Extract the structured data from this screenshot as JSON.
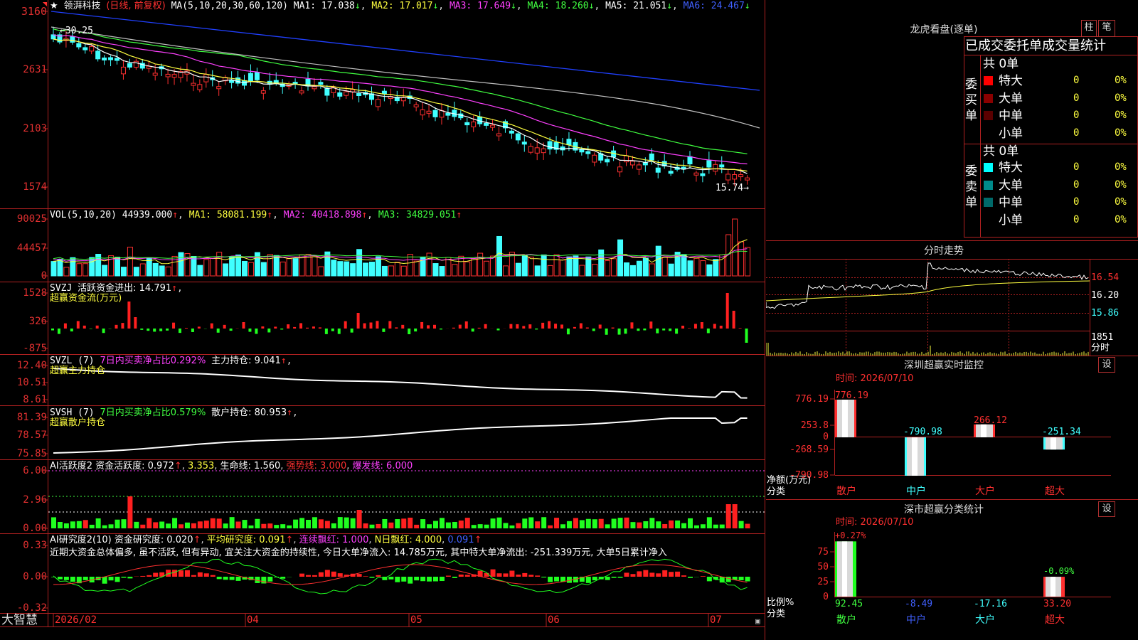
{
  "main_chart": {
    "stock_name": "领湃科技",
    "period": "(日线, 前复权)",
    "ma_params": "MA(5,10,20,30,60,120)",
    "ma": [
      {
        "label": "MA1: 17.038",
        "color": "#ffffff"
      },
      {
        "label": "MA2: 17.017",
        "color": "#ffff40"
      },
      {
        "label": "MA3: 17.649",
        "color": "#ff40ff"
      },
      {
        "label": "MA4: 18.260",
        "color": "#40ff40"
      },
      {
        "label": "MA5: 21.051",
        "color": "#ffffff"
      },
      {
        "label": "MA6: 24.467",
        "color": "#4060ff"
      }
    ],
    "y_ticks": [
      "3160",
      "2631",
      "2103",
      "1574"
    ],
    "high_label": "30.25",
    "low_label": "15.74"
  },
  "vol": {
    "title": "VOL(5,10,20)",
    "value": "44939.000",
    "ma1": "MA1: 58081.199",
    "ma2": "MA2: 40418.898",
    "ma3": "MA3: 34829.051",
    "y_ticks": [
      "90025",
      "44457",
      "0"
    ]
  },
  "svzj": {
    "title": "SVZJ",
    "line1": "活跃资金进出: 14.791",
    "line2": "超赢资金流(万元)",
    "y_ticks": [
      "1528",
      "326",
      "-875"
    ]
  },
  "svzl": {
    "title": "SVZL (7)",
    "ratio": "7日内买卖净占比0.292%",
    "hold": "主力持仓: 9.041",
    "line2": "超赢主力持仓",
    "y_ticks": [
      "12.40",
      "10.51",
      "8.61"
    ]
  },
  "svsh": {
    "title": "SVSH (7)",
    "ratio": "7日内买卖净占比0.579%",
    "hold": "散户持仓: 80.953",
    "line2": "超赢散户持仓",
    "y_ticks": [
      "81.39",
      "78.57",
      "75.85"
    ]
  },
  "ai_active": {
    "title": "AI活跃度2",
    "a": "资金活跃度: 0.972",
    "b": "3.353",
    "c": "生命线: 1.560",
    "d": "强势线: 3.000",
    "e": "爆发线: 6.000",
    "y_ticks": [
      "6.00",
      "2.96",
      "0.00"
    ]
  },
  "ai_research": {
    "title": "AI研究度2(10)",
    "a": "资金研究度: 0.020",
    "b": "平均研究度: 0.091",
    "c": "连续飘红: 1.000",
    "d": "N日飘红: 4.000",
    "e": "0.091",
    "comment": "近期大资金总体偏多, 虽不活跃, 但有异动, 宜关注大资金的持续性, 今日大单净流入: 14.785万元, 其中特大单净流出: -251.339万元, 大单5日累计净入",
    "y_ticks": [
      "0.33",
      "0.00",
      "-0.32"
    ]
  },
  "x_axis": {
    "brand": "大智慧",
    "labels": [
      "2026/02",
      "04",
      "05",
      "06",
      "07"
    ]
  },
  "longhu": {
    "title": "龙虎看盘(逐单)",
    "btn1": "柱",
    "btn2": "笔",
    "header": "已成交委托单成交量统计",
    "buy_side": "委买单",
    "sell_side": "委卖单",
    "buy_total": "共 0单",
    "sell_total": "共 0单",
    "buy_rows": [
      {
        "name": "特大",
        "count": "0",
        "pct": "0%",
        "color": "#ff0000"
      },
      {
        "name": "大单",
        "count": "0",
        "pct": "0%",
        "color": "#8b0000"
      },
      {
        "name": "中单",
        "count": "0",
        "pct": "0%",
        "color": "#5a0000"
      },
      {
        "name": "小单",
        "count": "0",
        "pct": "0%",
        "color": "#000000"
      }
    ],
    "sell_rows": [
      {
        "name": "特大",
        "count": "0",
        "pct": "0%",
        "color": "#00ffff"
      },
      {
        "name": "大单",
        "count": "0",
        "pct": "0%",
        "color": "#008b8b"
      },
      {
        "name": "中单",
        "count": "0",
        "pct": "0%",
        "color": "#006a6a"
      },
      {
        "name": "小单",
        "count": "0",
        "pct": "0%",
        "color": "#000000"
      }
    ]
  },
  "intraday": {
    "title": "分时走势",
    "prices": [
      "16.54",
      "16.20",
      "15.86"
    ],
    "vol_tick": "1851",
    "unit": "分时"
  },
  "monitor": {
    "title": "深圳超赢实时监控",
    "btn": "设",
    "time": "时间: 2026/07/10",
    "y_ticks": [
      "776.19",
      "253.8",
      "0",
      "-268.59",
      "-790.98"
    ],
    "y_label": "净额(万元)",
    "x_label": "分类",
    "chart_data": {
      "type": "bar",
      "categories": [
        "散户",
        "中户",
        "大户",
        "超大"
      ],
      "values": [
        776.19,
        -790.98,
        266.12,
        -251.34
      ],
      "value_labels": [
        "776.19",
        "-790.98",
        "266.12",
        "-251.34"
      ],
      "ylim": [
        -790.98,
        776.19
      ],
      "ylabel": "净额(万元)",
      "xlabel": "分类"
    }
  },
  "category_stats": {
    "title": "深市超赢分类统计",
    "btn": "设",
    "time": "时间: 2026/07/10",
    "y_ticks": [
      "75",
      "50",
      "25",
      "0"
    ],
    "y_label": "比例%",
    "x_label": "分类",
    "top_labels": [
      "+0.27%",
      "-0.09%"
    ],
    "chart_data": {
      "type": "bar",
      "categories": [
        "散户",
        "中户",
        "大户",
        "超大"
      ],
      "values": [
        92.45,
        8.49,
        17.16,
        33.2
      ],
      "value_labels": [
        "92.45",
        "-8.49",
        "-17.16",
        "33.20"
      ],
      "ylim": [
        0,
        100
      ]
    }
  }
}
